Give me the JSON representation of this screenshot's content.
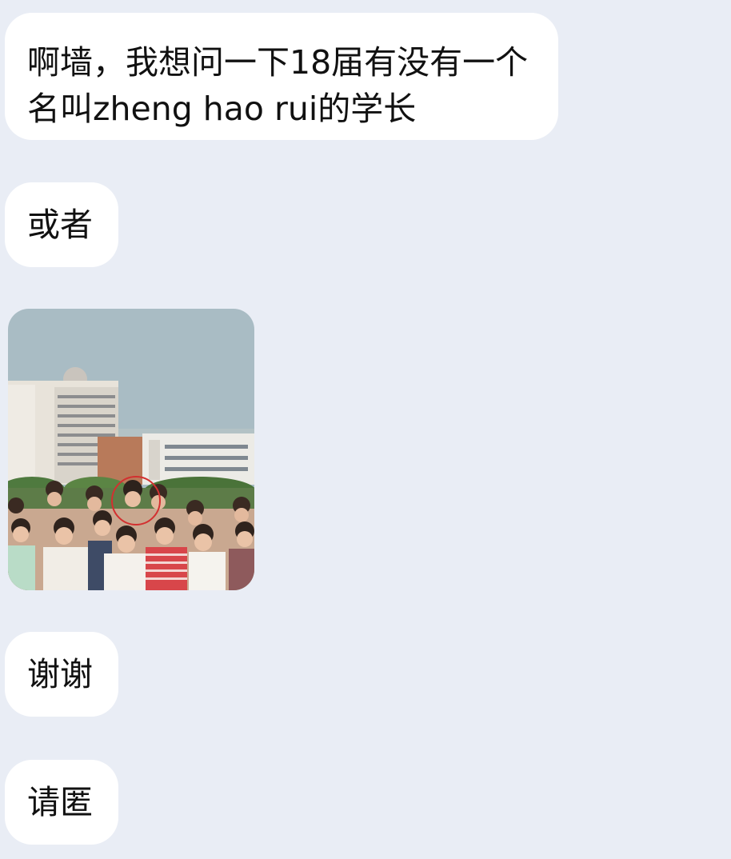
{
  "chat": {
    "messages": [
      {
        "text": "啊墙，我想问一下18届有没有一个名叫zheng hao rui的学长"
      },
      {
        "text": "或者"
      },
      {
        "type": "image",
        "icon": "photo-icon"
      },
      {
        "text": "谢谢"
      },
      {
        "text": "请匿"
      }
    ]
  },
  "colors": {
    "background": "#e9edf5",
    "bubble": "#ffffff",
    "text": "#111111",
    "highlight_circle": "#d33030"
  }
}
